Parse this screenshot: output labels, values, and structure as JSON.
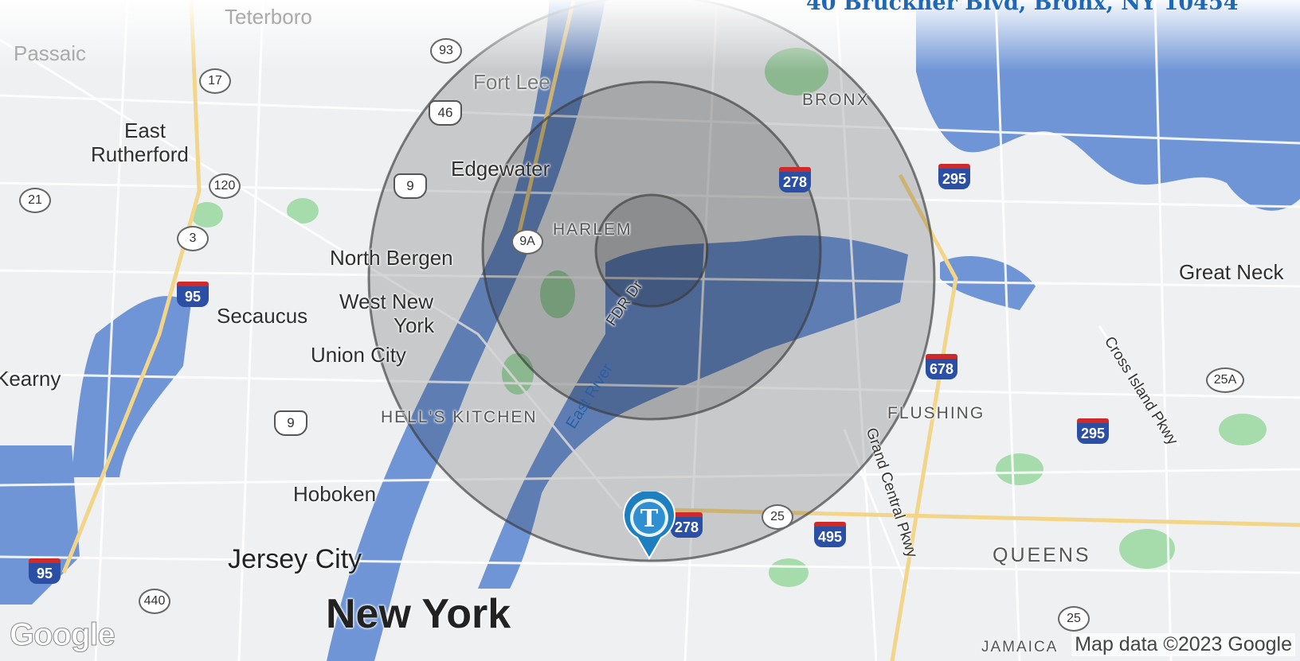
{
  "address": "40 Bruckner Blvd, Bronx, NY 10454",
  "labels": {
    "passaic": "Passaic",
    "teterboro": "Teterboro",
    "fort_lee": "Fort Lee",
    "bronx": "BRONX",
    "east_rutherford_1": "East",
    "east_rutherford_2": "Rutherford",
    "edgewater": "Edgewater",
    "harlem": "HARLEM",
    "north_bergen": "North Bergen",
    "west_new_york_1": "West New",
    "west_new_york_2": "York",
    "secaucus": "Secaucus",
    "union_city": "Union City",
    "kearny": "Kearny",
    "hells_kitchen": "HELL'S KITCHEN",
    "flushing": "FLUSHING",
    "great_neck": "Great Neck",
    "hoboken": "Hoboken",
    "jersey_city": "Jersey City",
    "new_york": "New York",
    "queens": "QUEENS",
    "jamaica": "JAMAICA",
    "fdr_dr": "FDR Dr",
    "east_river": "East River",
    "grand_central_pkwy": "Grand Central Pkwy",
    "cross_island_pkwy": "Cross Island Pkwy"
  },
  "shields": {
    "rt93": "93",
    "rt17": "17",
    "us46": "46",
    "rt120": "120",
    "rt21": "21",
    "us9_a": "9",
    "rt3": "3",
    "rt9a": "9A",
    "i95_a": "95",
    "i278": "278",
    "i295_a": "295",
    "i678": "678",
    "rt25a": "25A",
    "i295_b": "295",
    "us9_b": "9",
    "rt25_a": "25",
    "i495": "495",
    "i278_b": "278",
    "i95_b": "95",
    "rt440": "440",
    "rt25_b": "25"
  },
  "radius_rings": {
    "count": 3,
    "fill_color": "#000000",
    "stroke_color": "#3a3a3a"
  },
  "marker": {
    "icon": "map-pin-icon",
    "letter": "T",
    "color": "#1e7fc0"
  },
  "colors": {
    "water": "#6f95d6",
    "land": "#eef0f2",
    "park": "#a6dcab",
    "road": "#ffffff",
    "address": "#1f68b5"
  },
  "footer": {
    "logo": "Google",
    "attribution": "Map data ©2023 Google"
  }
}
